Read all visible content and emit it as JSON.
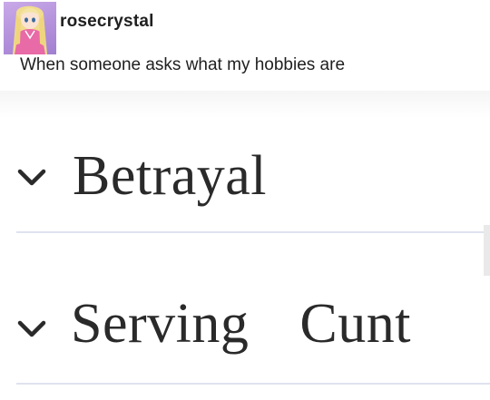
{
  "post": {
    "username": "rosecrystal",
    "caption": "When someone asks what my hobbies are"
  },
  "image": {
    "items": [
      {
        "label": "Betrayal"
      },
      {
        "label": "Serving  Cunt"
      }
    ]
  },
  "colors": {
    "text": "#1f1f1f",
    "divider": "#dfe3f0",
    "avatar_bg": "#b18fda"
  },
  "icons": [
    "avatar-anime-girl",
    "chevron-down-icon"
  ]
}
